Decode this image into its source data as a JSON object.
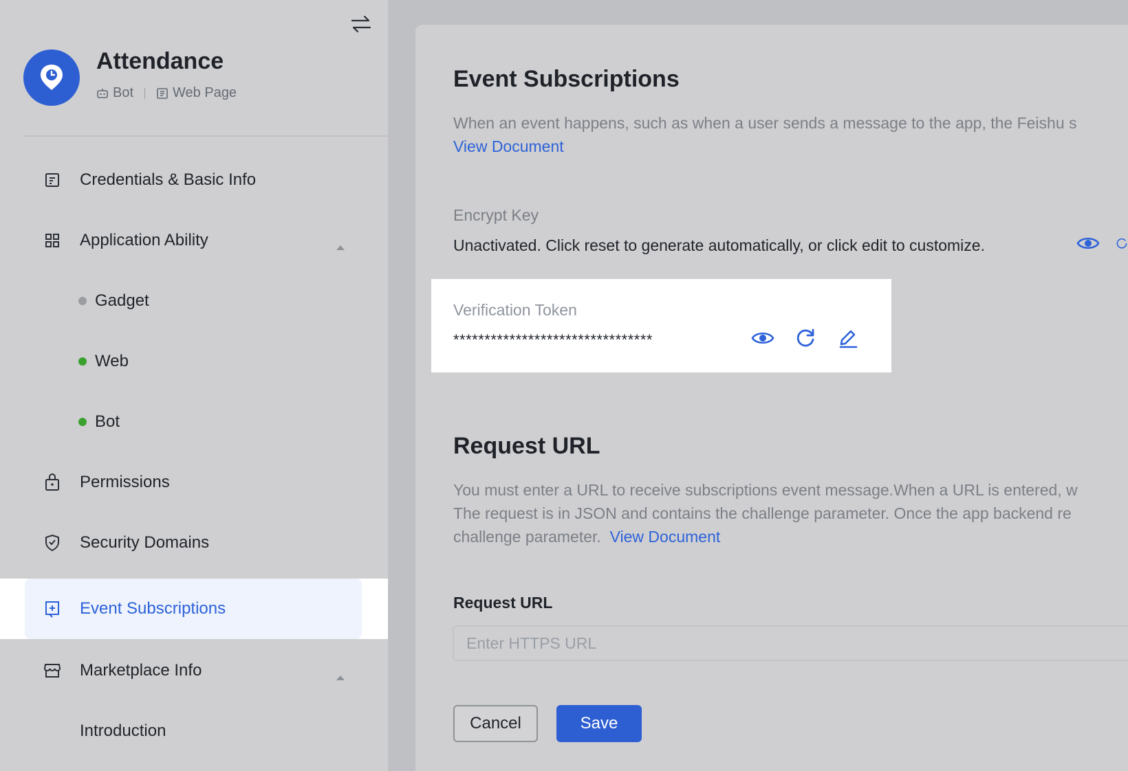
{
  "app": {
    "name": "Attendance",
    "tags": [
      "Bot",
      "Web Page"
    ]
  },
  "sidebar": {
    "items": [
      {
        "label": "Credentials & Basic Info",
        "icon": "document-icon"
      },
      {
        "label": "Application Ability",
        "icon": "grid-icon",
        "expanded": true
      },
      {
        "label": "Gadget",
        "status": "gray"
      },
      {
        "label": "Web",
        "status": "green"
      },
      {
        "label": "Bot",
        "status": "green"
      },
      {
        "label": "Permissions",
        "icon": "lock-icon"
      },
      {
        "label": "Security Domains",
        "icon": "shield-icon"
      },
      {
        "label": "Event Subscriptions",
        "icon": "plus-square-icon",
        "active": true
      },
      {
        "label": "Marketplace Info",
        "icon": "store-icon",
        "expanded": true
      },
      {
        "label": "Introduction"
      }
    ]
  },
  "main": {
    "title": "Event Subscriptions",
    "description": "When an event happens, such as when a user sends a message to the app, the Feishu s",
    "view_document": "View Document",
    "encrypt_key": {
      "label": "Encrypt Key",
      "text": "Unactivated. Click reset to generate automatically, or click edit to customize."
    },
    "verification_token": {
      "label": "Verification Token",
      "value": "********************************"
    },
    "request_url_section": {
      "title": "Request URL",
      "desc_line1": "You must enter a URL to receive subscriptions event message.When a URL is entered, w",
      "desc_line2": "The request is in JSON and contains the challenge parameter. Once the app backend re",
      "desc_line3": "challenge parameter.",
      "view_document": "View Document"
    },
    "request_url_field": {
      "label": "Request URL",
      "placeholder": "Enter HTTPS URL",
      "value": ""
    },
    "buttons": {
      "cancel": "Cancel",
      "save": "Save"
    }
  },
  "colors": {
    "accent": "#2d5fd3",
    "link": "#2d62d9",
    "status_green": "#3aa12f",
    "status_gray": "#9a9ca1"
  }
}
